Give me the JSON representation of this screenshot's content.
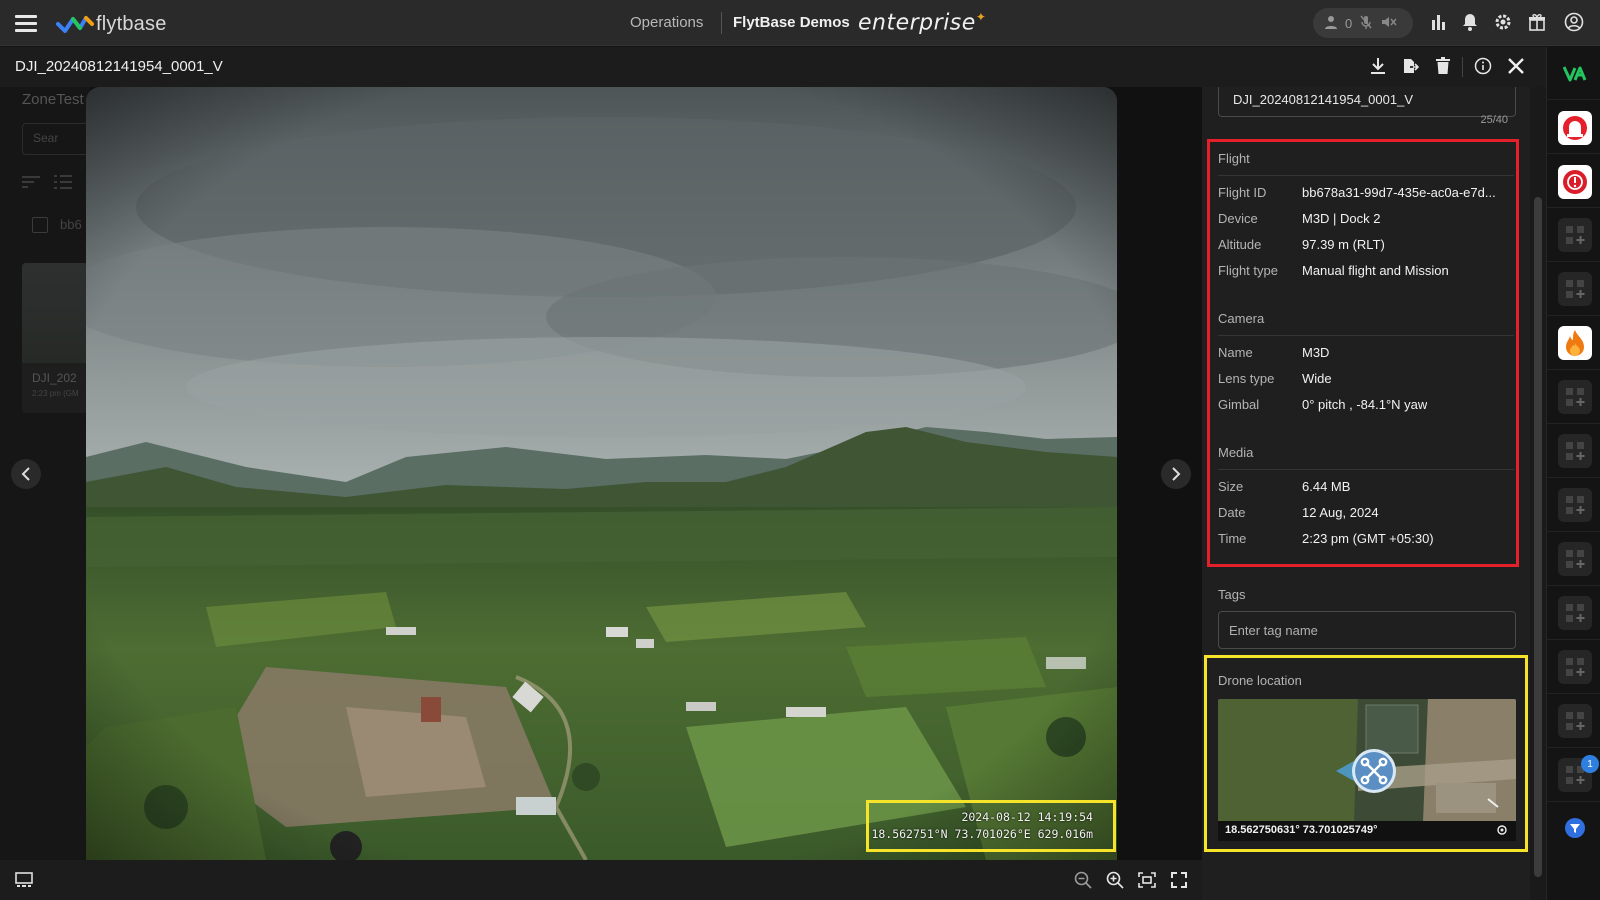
{
  "topbar": {
    "logo_text": "flytbase",
    "nav_operations": "Operations",
    "org_name": "FlytBase Demos",
    "edition": "enterprise",
    "user_count": "0",
    "icons": [
      "menu-icon",
      "user-icon",
      "mic-off-icon",
      "speaker-off-icon",
      "analytics-icon",
      "bell-icon",
      "gear-icon",
      "gift-icon",
      "account-icon"
    ]
  },
  "file": {
    "title": "DJI_20240812141954_0001_V",
    "actions": [
      "download-icon",
      "export-icon",
      "delete-icon",
      "info-icon",
      "close-icon"
    ]
  },
  "background_list": {
    "zone_label": "ZoneTest",
    "search_placeholder": "Sear",
    "row_partial": "bb6",
    "card_title": "DJI_202",
    "card_sub": "2:23 pm (GM"
  },
  "overlay": {
    "timestamp": "2024-08-12 14:19:54",
    "coords": "18.562751°N 73.701026°E 629.016m",
    "highlight_color": "#f5e42a"
  },
  "panel": {
    "name_value": "DJI_20240812141954_0001_V",
    "char_count": "25/40",
    "highlight_color": "#e5202a",
    "flight": {
      "title": "Flight",
      "rows": [
        {
          "label": "Flight ID",
          "value": "bb678a31-99d7-435e-ac0a-e7d..."
        },
        {
          "label": "Device",
          "value": "M3D | Dock 2"
        },
        {
          "label": "Altitude",
          "value": "97.39 m (RLT)"
        },
        {
          "label": "Flight type",
          "value": "Manual flight and Mission"
        }
      ]
    },
    "camera": {
      "title": "Camera",
      "rows": [
        {
          "label": "Name",
          "value": "M3D"
        },
        {
          "label": "Lens type",
          "value": "Wide"
        },
        {
          "label": "Gimbal",
          "value": "0° pitch , -84.1°N yaw"
        }
      ]
    },
    "media": {
      "title": "Media",
      "rows": [
        {
          "label": "Size",
          "value": "6.44 MB"
        },
        {
          "label": "Date",
          "value": "12 Aug, 2024"
        },
        {
          "label": "Time",
          "value": "2:23 pm (GMT +05:30)"
        }
      ]
    },
    "tags": {
      "label": "Tags",
      "placeholder": "Enter tag name"
    },
    "drone_location": {
      "label": "Drone location",
      "coords": "18.562750631°  73.701025749°"
    }
  },
  "bottombar": {
    "icons": [
      "gallery-toggle-icon",
      "zoom-out-icon",
      "zoom-in-icon",
      "fit-screen-icon",
      "fullscreen-icon"
    ]
  },
  "rightrail": {
    "notification_count": "1",
    "buttons": [
      "va-logo-icon",
      "siren-icon",
      "alert-badge-icon",
      "add-widget-icon",
      "add-widget-icon",
      "fire-icon",
      "add-widget-icon",
      "add-widget-icon",
      "add-widget-icon",
      "add-widget-icon",
      "add-widget-icon",
      "add-widget-icon",
      "add-widget-icon",
      "add-widget-icon",
      "filter-icon"
    ]
  }
}
